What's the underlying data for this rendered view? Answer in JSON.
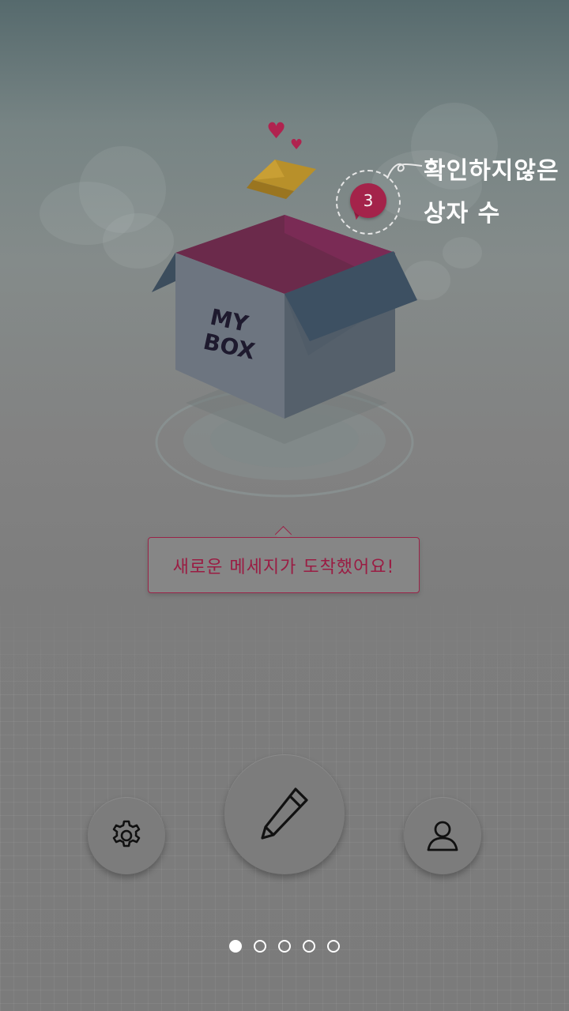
{
  "app": {
    "box_label_line1": "MY",
    "box_label_line2": "BOX"
  },
  "unread": {
    "count": "3",
    "hint_line1": "확인하지않은",
    "hint_line2": "상자 수"
  },
  "message_bubble": {
    "text": "새로운 메세지가 도착했어요!"
  },
  "actions": {
    "settings_icon": "gear-icon",
    "write_icon": "pencil-icon",
    "profile_icon": "user-icon"
  },
  "pager": {
    "total_pages": 5,
    "active_index": 0
  },
  "colors": {
    "accent": "#a4234a",
    "box_lid": "#6b2a4b",
    "box_side": "#5f6b75"
  }
}
